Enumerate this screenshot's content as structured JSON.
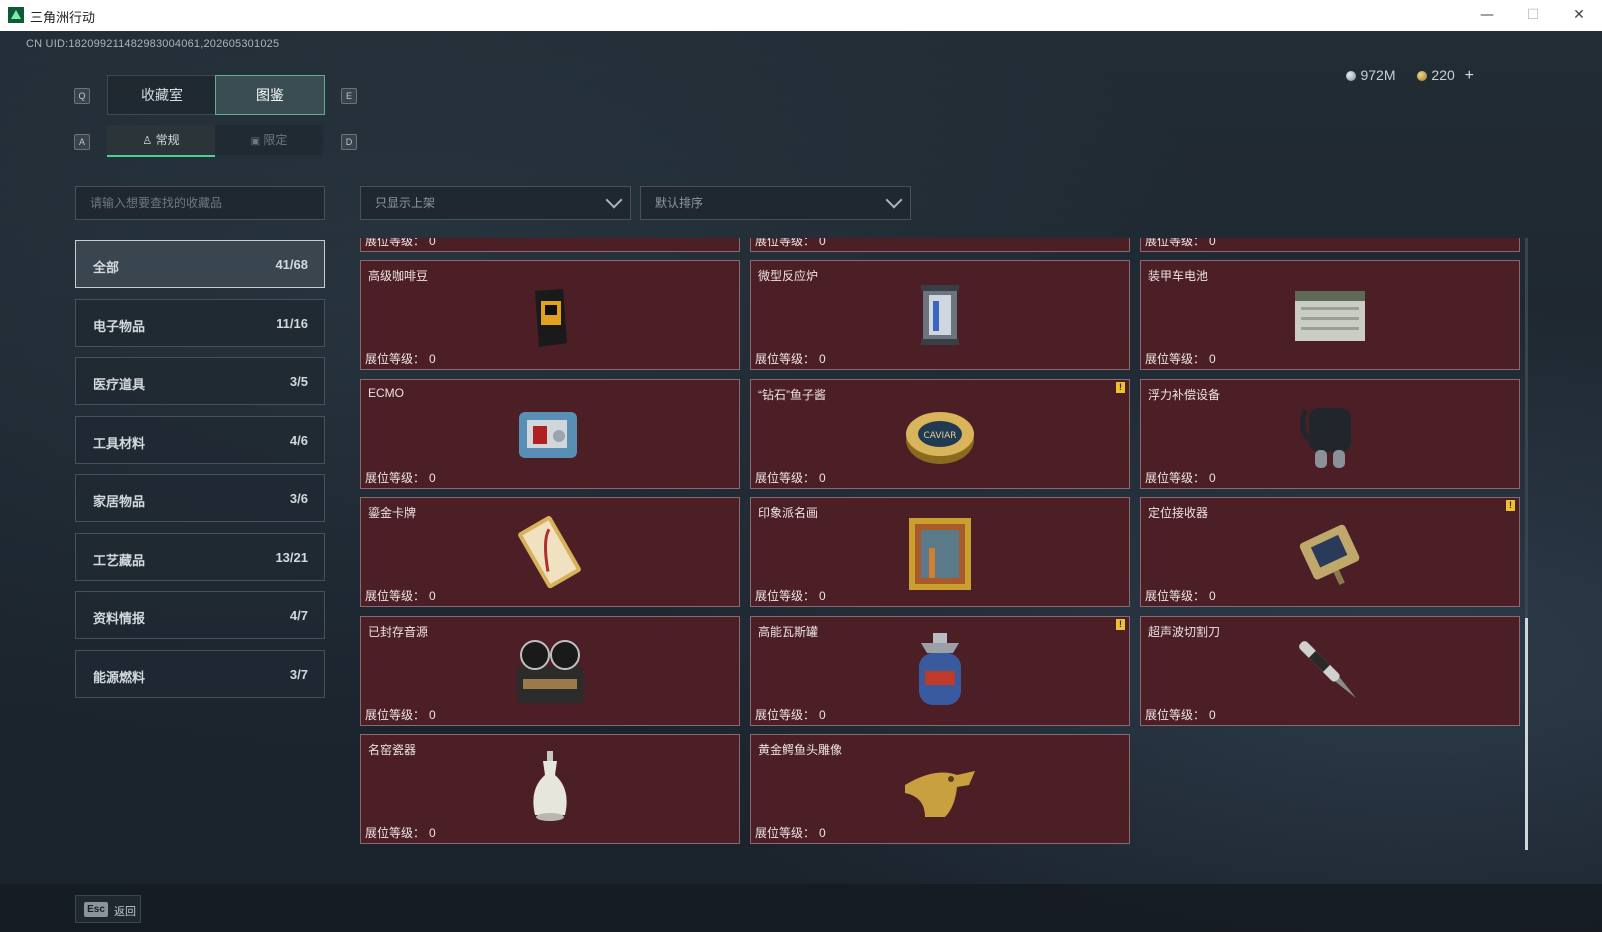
{
  "window": {
    "title": "三角洲行动",
    "minimize": "—",
    "maximize": "☐",
    "close": "✕"
  },
  "header": {
    "uid": "CN UID:18209921148298300406​1,202605301025",
    "silver_amount": "972M",
    "gold_amount": "220",
    "add_label": "+"
  },
  "tabs": {
    "key_left": "Q",
    "key_right": "E",
    "items": [
      {
        "label": "收藏室",
        "active": false
      },
      {
        "label": "图鉴",
        "active": true
      }
    ]
  },
  "subtabs": {
    "key_left": "A",
    "key_right": "D",
    "items": [
      {
        "label": "常规",
        "icon": "bottle-icon",
        "active": true
      },
      {
        "label": "限定",
        "icon": "image-icon",
        "active": false
      }
    ]
  },
  "search": {
    "placeholder": "请输入想要查找的收藏品",
    "value": ""
  },
  "filters": {
    "shelf_filter": "只显示上架",
    "sort": "默认排序"
  },
  "categories": [
    {
      "name": "全部",
      "count": "41/68",
      "active": true
    },
    {
      "name": "电子物品",
      "count": "11/16"
    },
    {
      "name": "医疗道具",
      "count": "3/5"
    },
    {
      "name": "工具材料",
      "count": "4/6"
    },
    {
      "name": "家居物品",
      "count": "3/6"
    },
    {
      "name": "工艺藏品",
      "count": "13/21"
    },
    {
      "name": "资料情报",
      "count": "4/7"
    },
    {
      "name": "能源燃料",
      "count": "3/7"
    }
  ],
  "level_label": "展位等级：",
  "items": [
    {
      "name": "",
      "level": "0",
      "icon": "partial-icon",
      "flag": false
    },
    {
      "name": "",
      "level": "0",
      "icon": "partial-icon",
      "flag": false
    },
    {
      "name": "",
      "level": "0",
      "icon": "partial-icon",
      "flag": false
    },
    {
      "name": "高级咖啡豆",
      "level": "0",
      "icon": "coffee-bag-icon",
      "flag": false
    },
    {
      "name": "微型反应炉",
      "level": "0",
      "icon": "reactor-icon",
      "flag": false
    },
    {
      "name": "装甲车电池",
      "level": "0",
      "icon": "battery-icon",
      "flag": false
    },
    {
      "name": "ECMO",
      "level": "0",
      "icon": "ecmo-machine-icon",
      "flag": false
    },
    {
      "name": "“钻石”鱼子酱",
      "level": "0",
      "icon": "caviar-tin-icon",
      "flag": true
    },
    {
      "name": "浮力补偿设备",
      "level": "0",
      "icon": "buoyancy-vest-icon",
      "flag": false
    },
    {
      "name": "鎏金卡牌",
      "level": "0",
      "icon": "gilded-card-icon",
      "flag": false
    },
    {
      "name": "印象派名画",
      "level": "0",
      "icon": "framed-painting-icon",
      "flag": false
    },
    {
      "name": "定位接收器",
      "level": "0",
      "icon": "receiver-icon",
      "flag": true
    },
    {
      "name": "已封存音源",
      "level": "0",
      "icon": "tape-recorder-icon",
      "flag": false
    },
    {
      "name": "高能瓦斯罐",
      "level": "0",
      "icon": "gas-canister-icon",
      "flag": true
    },
    {
      "name": "超声波切割刀",
      "level": "0",
      "icon": "ultrasonic-knife-icon",
      "flag": false
    },
    {
      "name": "名窑瓷器",
      "level": "0",
      "icon": "porcelain-vase-icon",
      "flag": false
    },
    {
      "name": "黄金鳄鱼头雕像",
      "level": "0",
      "icon": "gold-crocodile-icon",
      "flag": false
    }
  ],
  "flag_mark": "!",
  "footer": {
    "esc_key": "Esc",
    "back_label": "返回"
  }
}
